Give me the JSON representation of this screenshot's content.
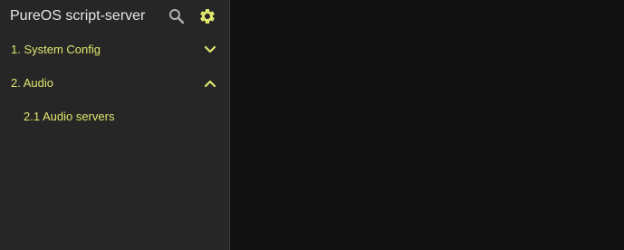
{
  "app": {
    "title": "PureOS script-server",
    "accent_color": "#dfe66e"
  },
  "header": {
    "search_icon": "search-icon",
    "settings_icon": "gear-icon"
  },
  "sidebar": {
    "groups": [
      {
        "label": "1. System Config",
        "expanded": false,
        "chevron_icon": "chevron-down-icon",
        "items": []
      },
      {
        "label": "2. Audio",
        "expanded": true,
        "chevron_icon": "chevron-up-icon",
        "items": [
          {
            "label": "2.1 Audio servers"
          }
        ]
      }
    ]
  }
}
